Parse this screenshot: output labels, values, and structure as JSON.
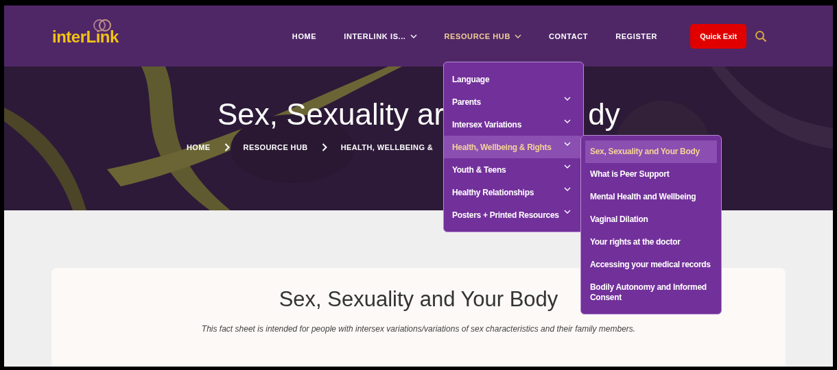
{
  "header": {
    "logo": "interLink",
    "nav": [
      {
        "label": "HOME",
        "dropdown": false,
        "selected": false
      },
      {
        "label": "INTERLINK IS...",
        "dropdown": true,
        "selected": false
      },
      {
        "label": "RESOURCE HUB",
        "dropdown": true,
        "selected": true
      },
      {
        "label": "CONTACT",
        "dropdown": false,
        "selected": false
      },
      {
        "label": "REGISTER",
        "dropdown": false,
        "selected": false
      }
    ],
    "quick_exit": "Quick Exit"
  },
  "hero": {
    "title_visible_parts": [
      "Sex, Sexuality ar",
      "dy"
    ],
    "breadcrumb": [
      "HOME",
      "RESOURCE HUB",
      "HEALTH, WELLBEING &"
    ]
  },
  "resource_menu": [
    {
      "label": "Language",
      "has_submenu": false,
      "selected": false
    },
    {
      "label": "Parents",
      "has_submenu": true,
      "selected": false
    },
    {
      "label": "Intersex Variations",
      "has_submenu": true,
      "selected": false
    },
    {
      "label": "Health, Wellbeing & Rights",
      "has_submenu": true,
      "selected": true
    },
    {
      "label": "Youth & Teens",
      "has_submenu": true,
      "selected": false
    },
    {
      "label": "Healthy Relationships",
      "has_submenu": true,
      "selected": false
    },
    {
      "label": "Posters + Printed Resources",
      "has_submenu": true,
      "selected": false
    }
  ],
  "submenu": [
    {
      "label": "Sex, Sexuality and Your Body",
      "selected": true
    },
    {
      "label": "What is Peer Support",
      "selected": false
    },
    {
      "label": "Mental Health and Wellbeing",
      "selected": false
    },
    {
      "label": "Vaginal Dilation",
      "selected": false
    },
    {
      "label": "Your rights at the doctor",
      "selected": false
    },
    {
      "label": "Accessing your medical records",
      "selected": false
    },
    {
      "label": "Bodily Autonomy and Informed Consent",
      "selected": false
    }
  ],
  "content": {
    "title": "Sex, Sexuality and Your Body",
    "intro": "This fact sheet is intended for people with intersex variations/variations of sex characteristics and their family members."
  }
}
